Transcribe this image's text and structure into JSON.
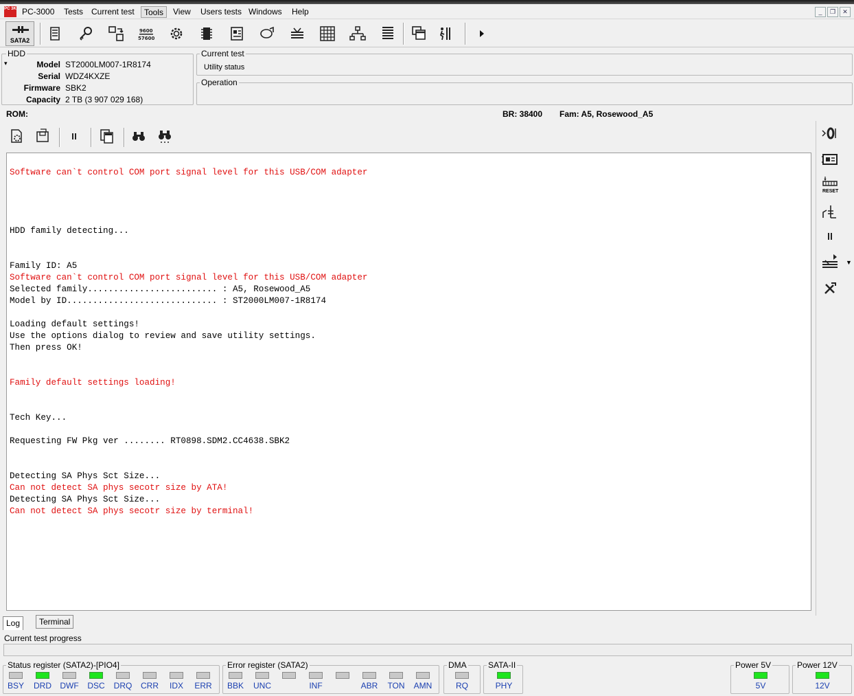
{
  "app": {
    "title": "PC-3000",
    "logo_text": "PC 3K"
  },
  "menu": [
    "Tests",
    "Current test",
    "Tools",
    "View",
    "Users tests",
    "Windows",
    "Help"
  ],
  "toolbar": {
    "sata_label": "SATA2"
  },
  "hdd": {
    "legend": "HDD",
    "model_label": "Model",
    "model": "ST2000LM007-1R8174",
    "serial_label": "Serial",
    "serial": "WDZ4KXZE",
    "firmware_label": "Firmware",
    "firmware": "SBK2",
    "capacity_label": "Capacity",
    "capacity": "2 TB (3 907 029 168)"
  },
  "current_test": {
    "legend": "Current test",
    "value": "Utility status"
  },
  "operation": {
    "legend": "Operation",
    "value": ""
  },
  "rom_line": {
    "rom": "ROM:",
    "br": "BR: 38400",
    "fam": "Fam: A5, Rosewood_A5"
  },
  "log": {
    "l1": "Software can`t control COM port signal level for this USB/COM adapter",
    "l2": "HDD family detecting...",
    "l3": "Family ID: A5",
    "l4": "Software can`t control COM port signal level for this USB/COM adapter",
    "l5": "Selected family......................... : A5, Rosewood_A5",
    "l6": "Model by ID............................. : ST2000LM007-1R8174",
    "l7": "Loading default settings!",
    "l8": "Use the options dialog to review and save utility settings.",
    "l9": "Then press OK!",
    "l10": "Family default settings loading!",
    "l11": "Tech Key...",
    "l12": "Requesting FW Pkg ver ........ RT0898.SDM2.CC4638.SBK2",
    "l13": "Detecting SA Phys Sct Size...",
    "l14": "Can not detect SA phys secotr size by ATA!",
    "l15": "Detecting SA Phys Sct Size...",
    "l16": "Can not detect SA phys secotr size by terminal!"
  },
  "right_toolbar": {
    "reset_label": "RESET"
  },
  "tabs": {
    "log": "Log",
    "terminal": "Terminal"
  },
  "progress": {
    "label": "Current test progress",
    "value": 0
  },
  "status_register": {
    "legend": "Status register (SATA2)-[PIO4]",
    "leds": [
      {
        "label": "BSY",
        "on": false
      },
      {
        "label": "DRD",
        "on": true
      },
      {
        "label": "DWF",
        "on": false
      },
      {
        "label": "DSC",
        "on": true
      },
      {
        "label": "DRQ",
        "on": false
      },
      {
        "label": "CRR",
        "on": false
      },
      {
        "label": "IDX",
        "on": false
      },
      {
        "label": "ERR",
        "on": false
      }
    ]
  },
  "error_register": {
    "legend": "Error register (SATA2)",
    "leds": [
      {
        "label": "BBK",
        "on": false
      },
      {
        "label": "UNC",
        "on": false
      },
      {
        "label": "",
        "on": false
      },
      {
        "label": "INF",
        "on": false
      },
      {
        "label": "",
        "on": false
      },
      {
        "label": "ABR",
        "on": false
      },
      {
        "label": "TON",
        "on": false
      },
      {
        "label": "AMN",
        "on": false
      }
    ]
  },
  "dma": {
    "legend": "DMA",
    "label": "RQ",
    "on": false
  },
  "sata2": {
    "legend": "SATA-II",
    "label": "PHY",
    "on": true
  },
  "power5": {
    "legend": "Power 5V",
    "label": "5V",
    "on": true
  },
  "power12": {
    "legend": "Power 12V",
    "label": "12V",
    "on": true
  },
  "colors": {
    "led_on": "#1ee51e",
    "led_off": "#c8c8c8",
    "error_text": "#e01010",
    "led_label": "#1a3fb0"
  }
}
